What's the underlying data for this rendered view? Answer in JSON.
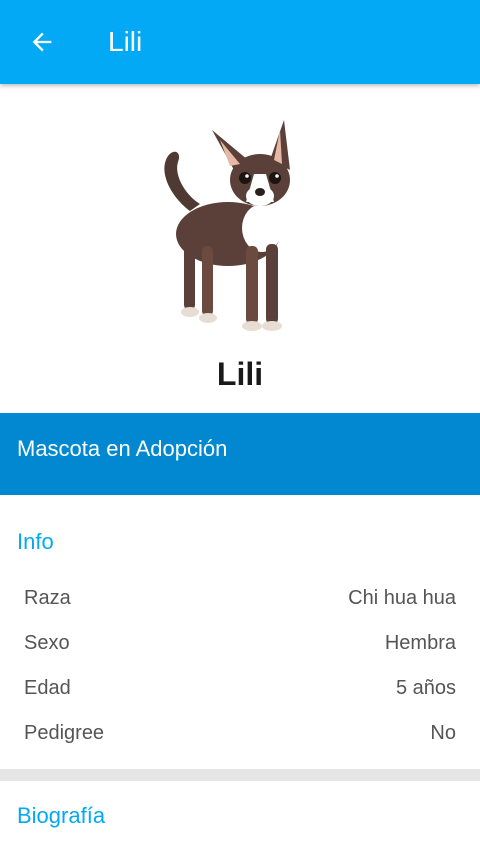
{
  "appbar": {
    "title": "Lili",
    "back_icon": "arrow-left-icon"
  },
  "pet": {
    "name": "Lili",
    "photo": "chihuahua-dog-photo"
  },
  "banner": {
    "text": "Mascota en Adopción"
  },
  "info": {
    "title": "Info",
    "rows": [
      {
        "label": "Raza",
        "value": "Chi hua hua"
      },
      {
        "label": "Sexo",
        "value": "Hembra"
      },
      {
        "label": "Edad",
        "value": "5 años"
      },
      {
        "label": "Pedigree",
        "value": "No"
      }
    ]
  },
  "bio": {
    "title": "Biografía"
  },
  "colors": {
    "primary": "#03a9f4",
    "primary_dark": "#0288d1",
    "divider": "#e6e6e6"
  }
}
